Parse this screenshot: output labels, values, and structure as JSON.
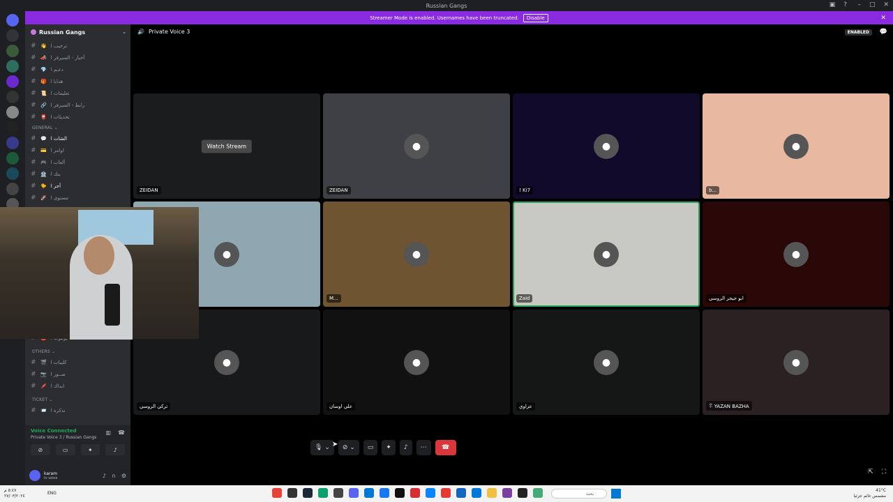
{
  "window": {
    "title": "Russian Gangs"
  },
  "banner": {
    "text": "Streamer Mode is enabled. Usernames have been truncated.",
    "button": "Disable"
  },
  "sidebar": {
    "guild_name": "Russian Gangs",
    "top_channels": [
      {
        "emoji": "👋",
        "label": "ترحيب ا"
      },
      {
        "emoji": "📣",
        "label": "أخبار - السيرفر ا"
      },
      {
        "emoji": "💎",
        "label": "دعـم ا"
      },
      {
        "emoji": "🎁",
        "label": "هدايا ا"
      },
      {
        "emoji": "📜",
        "label": "تعليمات ا"
      },
      {
        "emoji": "🔗",
        "label": "رابط - السيرفر ا"
      },
      {
        "emoji": "📮",
        "label": "تحديثات ا"
      }
    ],
    "category_general": "GENERAL",
    "general_channels": [
      {
        "emoji": "💬",
        "label": "الشات ا",
        "active": true
      },
      {
        "emoji": "💳",
        "label": "اوامر ا"
      },
      {
        "emoji": "🎮",
        "label": "ألعاب ا"
      },
      {
        "emoji": "🏦",
        "label": "بنك ا"
      },
      {
        "emoji": "🐤",
        "label": "أجر ا",
        "active": true
      },
      {
        "emoji": "🚀",
        "label": "مستوى ا"
      }
    ],
    "partial_channel": {
      "emoji": "🔴",
      "label": "يوتيوب ا"
    },
    "category_others": "OTHERS",
    "others_channels": [
      {
        "emoji": "🎬",
        "label": "كليبات ا"
      },
      {
        "emoji": "📷",
        "label": "صــور ا"
      },
      {
        "emoji": "🖍️",
        "label": "ابداك ا"
      }
    ],
    "category_ticket": "TICKET",
    "ticket_channels": [
      {
        "emoji": "📨",
        "label": "تذكرة ا"
      }
    ]
  },
  "voice_panel": {
    "status": "Voice Connected",
    "channel": "Private Voice 3 / Russian Gangs"
  },
  "user_panel": {
    "name": "karam",
    "status": "In voice"
  },
  "header": {
    "channel": "Private Voice 3",
    "enabled_badge": "ENABLED"
  },
  "tiles": [
    {
      "name": "ZEIDAN",
      "watch": "Watch Stream",
      "bg": "#1b1c1e"
    },
    {
      "name": "ZEIDAN",
      "bg": "#3e4046"
    },
    {
      "name": "! Ki7",
      "bg": "#120a2a"
    },
    {
      "name": "b...",
      "bg": "#e8b8a0"
    },
    {
      "name": "",
      "bg": "#8ea7b0"
    },
    {
      "name": "M...",
      "bg": "#6e5430"
    },
    {
      "name": "Zaid",
      "bg": "#c9c9c4",
      "speaking": true
    },
    {
      "name": "ابو جيجر الروسي",
      "bg": "#2a0808"
    },
    {
      "name": "تركي الروسي",
      "bg": "#18191b"
    },
    {
      "name": "علي اوسان",
      "bg": "#111112"
    },
    {
      "name": "عزاوي",
      "bg": "#151616"
    },
    {
      "name": "ꋖ YAZAN BAZHA",
      "bg": "#2b2122"
    }
  ],
  "colors": {
    "banner": "#8a2be2",
    "end_call": "#da373c",
    "voice_connected": "#23a55a"
  },
  "taskbar": {
    "left_line1": "٥:٤٧ م",
    "left_line2": "٢٧/٠٣/٢٠٢٤",
    "lang": "ENG",
    "search": "بحث",
    "weather_temp": "41°C",
    "weather_desc": "مشمس غائم جزئيا"
  }
}
